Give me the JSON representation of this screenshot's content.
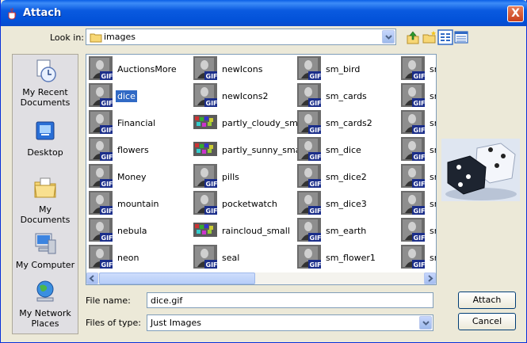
{
  "window": {
    "title": "Attach",
    "close_label": "X"
  },
  "lookin": {
    "label": "Look in:",
    "value": "images"
  },
  "places": [
    {
      "label": "My Recent Documents",
      "icon": "recent-documents-icon"
    },
    {
      "label": "Desktop",
      "icon": "desktop-icon"
    },
    {
      "label": "My Documents",
      "icon": "my-documents-icon"
    },
    {
      "label": "My Computer",
      "icon": "my-computer-icon"
    },
    {
      "label": "My Network Places",
      "icon": "network-places-icon"
    }
  ],
  "files": {
    "col1": [
      "AuctionsMore",
      "dice",
      "Financial",
      "flowers",
      "Money",
      "mountain",
      "nebula",
      "neon"
    ],
    "col2": [
      "newIcons",
      "newIcons2",
      "partly_cloudy_small",
      "partly_sunny_small",
      "pills",
      "pocketwatch",
      "raincloud_small",
      "seal"
    ],
    "col3": [
      "sm_bird",
      "sm_cards",
      "sm_cards2",
      "sm_dice",
      "sm_dice2",
      "sm_dice3",
      "sm_earth",
      "sm_flower1"
    ],
    "col4": [
      "sm",
      "sm",
      "sm",
      "sm",
      "sm",
      "sm",
      "sm",
      "sm"
    ],
    "selected": "dice",
    "png_items": [
      "partly_cloudy_small",
      "partly_sunny_small",
      "raincloud_small"
    ],
    "badge": "GIF"
  },
  "filename": {
    "label": "File name:",
    "value": "dice.gif"
  },
  "filetype": {
    "label": "Files of type:",
    "value": "Just Images"
  },
  "buttons": {
    "attach": "Attach",
    "cancel": "Cancel"
  },
  "colors": {
    "title_bar": "#0a5ae0",
    "selection": "#316ac5",
    "dialog_bg": "#ece9d8"
  }
}
